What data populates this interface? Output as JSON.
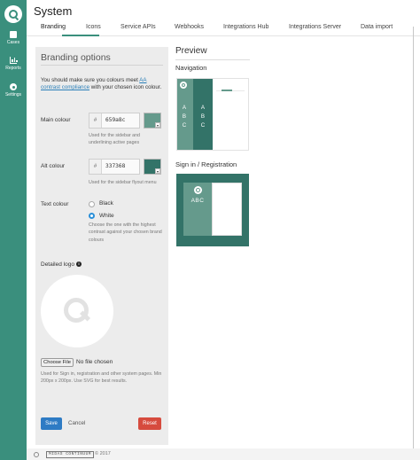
{
  "app": {
    "title": "System"
  },
  "sidebar": {
    "items": [
      {
        "label": "Cases",
        "icon": "cases-icon"
      },
      {
        "label": "Reports",
        "icon": "reports-icon"
      },
      {
        "label": "Settings",
        "icon": "settings-icon"
      }
    ]
  },
  "tabs": [
    {
      "label": "Branding",
      "active": true
    },
    {
      "label": "Icons",
      "active": false
    },
    {
      "label": "Service APIs",
      "active": false
    },
    {
      "label": "Webhooks",
      "active": false
    },
    {
      "label": "Integrations Hub",
      "active": false
    },
    {
      "label": "Integrations Server",
      "active": false
    },
    {
      "label": "Data import",
      "active": false
    }
  ],
  "branding": {
    "title": "Branding options",
    "warning_prefix": "You should make sure you colours meet ",
    "warning_link": "AA contrast compliance",
    "warning_suffix": " with your chosen icon colour.",
    "main_colour": {
      "label": "Main colour",
      "hash": "#",
      "value": "659a8c",
      "help": "Used for the sidebar and underlining active pages"
    },
    "alt_colour": {
      "label": "Alt colour",
      "hash": "#",
      "value": "337368",
      "help": "Used for the sidebar flyout menu"
    },
    "text_colour": {
      "label": "Text colour",
      "options": [
        "Black",
        "White"
      ],
      "selected": "White",
      "help": "Choose the one with the highest contrast against your chosen brand colours"
    },
    "logo": {
      "label": "Detailed logo",
      "info_glyph": "i",
      "choose_label": "Choose File",
      "file_status": "No file chosen",
      "help": "Used for Sign in, registration and other system pages. Min 200px x 200px. Use SVG for best results."
    },
    "actions": {
      "save": "Save",
      "cancel": "Cancel",
      "reset": "Reset"
    }
  },
  "preview": {
    "title": "Preview",
    "navigation_label": "Navigation",
    "signin_label": "Sign in / Registration",
    "sample_letters": [
      "A",
      "B",
      "C"
    ],
    "sample_text": "ABC"
  },
  "footer": {
    "brand": "MIDAS CONTINUUM",
    "copyright": "© 2017"
  },
  "colors": {
    "sidebar": "#3a8f7d",
    "main": "#659a8c",
    "alt": "#337368",
    "save": "#2e7bc4",
    "reset": "#d64b3e",
    "link": "#2a7fb8"
  }
}
